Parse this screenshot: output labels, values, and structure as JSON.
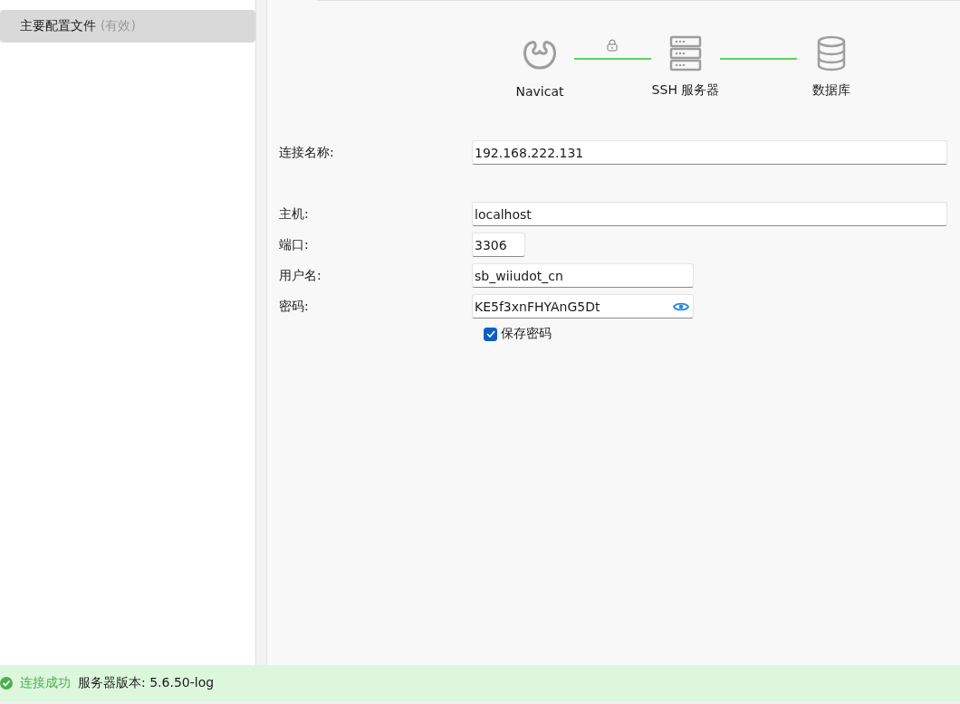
{
  "sidebar": {
    "items": [
      {
        "label": "主要配置文件",
        "note": "(有效)",
        "selected": true
      }
    ]
  },
  "diagram": {
    "nodes": [
      {
        "kind": "navicat",
        "label": "Navicat"
      },
      {
        "kind": "server",
        "label": "SSH 服务器"
      },
      {
        "kind": "database",
        "label": "数据库"
      }
    ],
    "tunnel_locked": true
  },
  "form": {
    "fields": [
      {
        "label": "连接名称:",
        "value": "192.168.222.131",
        "kind": "name"
      },
      {
        "label": "主机:",
        "value": "localhost",
        "kind": "host"
      },
      {
        "label": "端口:",
        "value": "3306",
        "kind": "port"
      },
      {
        "label": "用户名:",
        "value": "sb_wiiudot_cn",
        "kind": "user"
      },
      {
        "label": "密码:",
        "value": "KE5f3xnFHYAnG5Dt",
        "kind": "password"
      }
    ],
    "save_password": {
      "label": "保存密码",
      "checked": true
    }
  },
  "status_bar": {
    "message": "连接成功",
    "detail": "服务器版本: 5.6.50-log"
  }
}
